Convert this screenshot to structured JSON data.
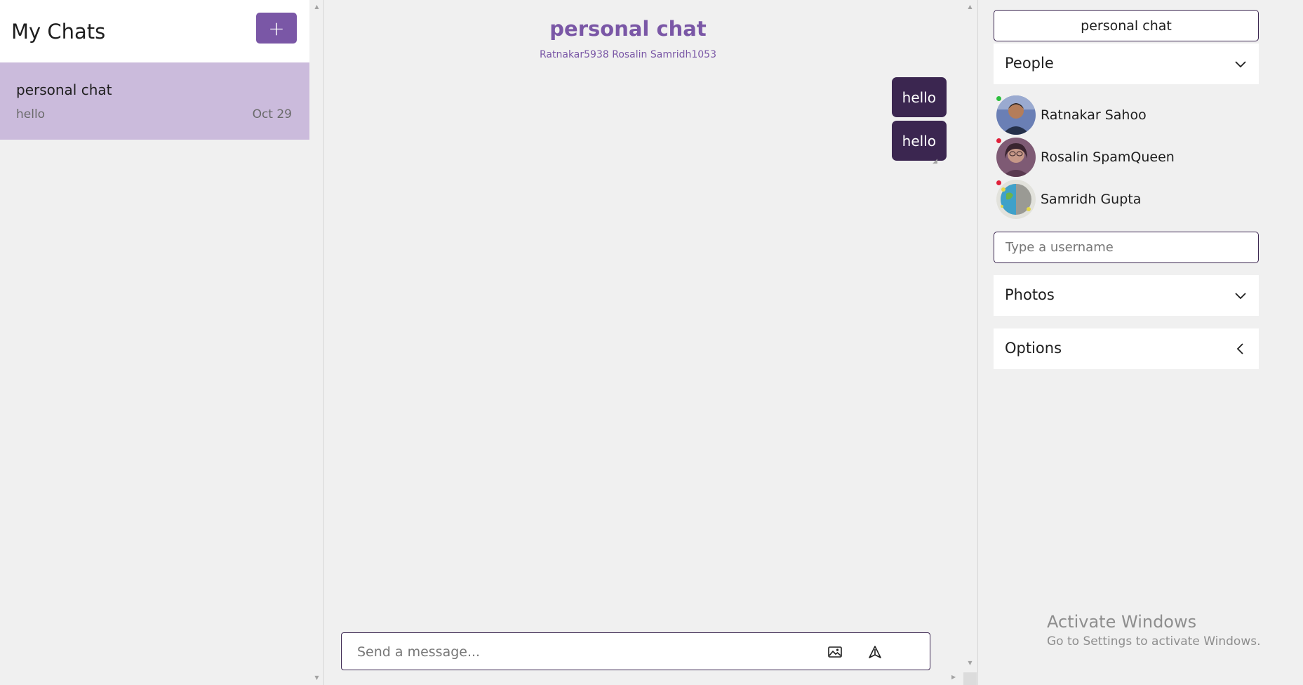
{
  "left": {
    "title": "My Chats",
    "new_chat_label": "+",
    "chats": [
      {
        "title": "personal chat",
        "last_message": "hello",
        "date": "Oct 29"
      }
    ]
  },
  "middle": {
    "title": "personal chat",
    "members": "Ratnakar5938 Rosalin Samridh1053",
    "messages": [
      {
        "text": "hello"
      },
      {
        "text": "hello"
      }
    ],
    "composer": {
      "placeholder": "Send a message...",
      "image_icon": "image-icon",
      "send_icon": "send-icon"
    }
  },
  "right": {
    "chat_name": "personal chat",
    "people_label": "People",
    "people": [
      {
        "name": "Ratnakar Sahoo",
        "status": "online",
        "status_color": "#2dbf3e"
      },
      {
        "name": "Rosalin SpamQueen",
        "status": "offline",
        "status_color": "#e0203a"
      },
      {
        "name": "Samridh Gupta",
        "status": "offline",
        "status_color": "#e0203a"
      }
    ],
    "username_placeholder": "Type a username",
    "photos_label": "Photos",
    "options_label": "Options"
  },
  "watermark": {
    "title": "Activate Windows",
    "subtitle": "Go to Settings to activate Windows."
  },
  "colors": {
    "accent": "#7a57a6",
    "bubble": "#3b2650",
    "selected_chat": "#cbbbdc"
  }
}
